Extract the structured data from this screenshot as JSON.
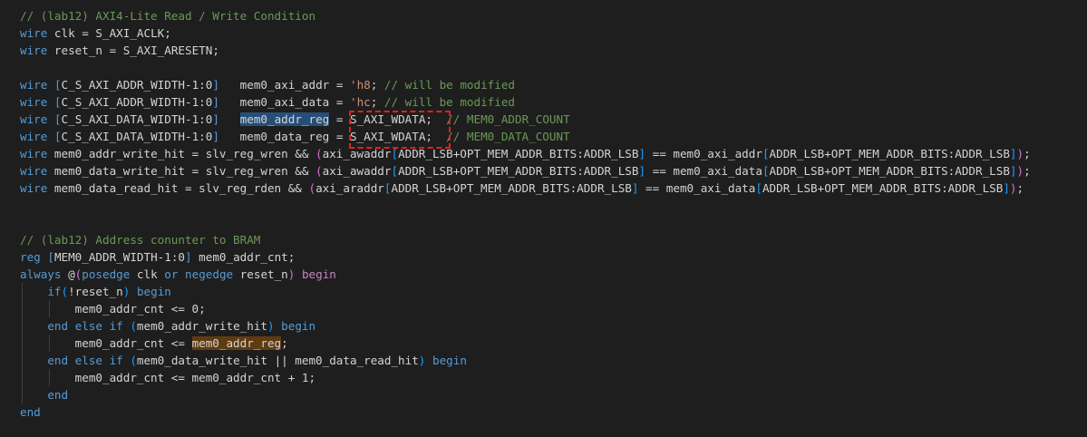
{
  "editor": {
    "lines": [
      [
        {
          "t": "// (lab12) AXI4-Lite Read / Write Condition",
          "c": "comment"
        }
      ],
      [
        {
          "t": "wire",
          "c": "keyword"
        },
        {
          "t": " clk = S_AXI_ACLK;",
          "c": "ident"
        }
      ],
      [
        {
          "t": "wire",
          "c": "keyword"
        },
        {
          "t": " reset_n = S_AXI_ARESETN;",
          "c": "ident"
        }
      ],
      [],
      [
        {
          "t": "wire",
          "c": "keyword"
        },
        {
          "t": " ",
          "c": "ident"
        },
        {
          "t": "[",
          "c": "bracket"
        },
        {
          "t": "C_S_AXI_ADDR_WIDTH-1:0",
          "c": "ident"
        },
        {
          "t": "]",
          "c": "bracket"
        },
        {
          "t": "   mem0_axi_addr = ",
          "c": "ident"
        },
        {
          "t": "'h8",
          "c": "string"
        },
        {
          "t": "; ",
          "c": "ident"
        },
        {
          "t": "// will be modified",
          "c": "comment"
        }
      ],
      [
        {
          "t": "wire",
          "c": "keyword"
        },
        {
          "t": " ",
          "c": "ident"
        },
        {
          "t": "[",
          "c": "bracket"
        },
        {
          "t": "C_S_AXI_ADDR_WIDTH-1:0",
          "c": "ident"
        },
        {
          "t": "]",
          "c": "bracket"
        },
        {
          "t": "   mem0_axi_data = ",
          "c": "ident"
        },
        {
          "t": "'hc",
          "c": "string"
        },
        {
          "t": "; ",
          "c": "ident"
        },
        {
          "t": "// will be modified",
          "c": "comment"
        }
      ],
      [
        {
          "t": "wire",
          "c": "keyword"
        },
        {
          "t": " ",
          "c": "ident"
        },
        {
          "t": "[",
          "c": "bracket"
        },
        {
          "t": "C_S_AXI_DATA_WIDTH-1:0",
          "c": "ident"
        },
        {
          "t": "]",
          "c": "bracket"
        },
        {
          "t": "   ",
          "c": "ident"
        },
        {
          "t": "mem0_addr_reg",
          "c": "sel"
        },
        {
          "t": " = S_AXI_WDATA;  ",
          "c": "ident"
        },
        {
          "t": "// MEM0_ADDR_COUNT",
          "c": "comment"
        }
      ],
      [
        {
          "t": "wire",
          "c": "keyword"
        },
        {
          "t": " ",
          "c": "ident"
        },
        {
          "t": "[",
          "c": "bracket"
        },
        {
          "t": "C_S_AXI_DATA_WIDTH-1:0",
          "c": "ident"
        },
        {
          "t": "]",
          "c": "bracket"
        },
        {
          "t": "   mem0_data_reg = S_AXI_WDATA;  ",
          "c": "ident"
        },
        {
          "t": "// MEM0_DATA_COUNT",
          "c": "comment"
        }
      ],
      [
        {
          "t": "wire",
          "c": "keyword"
        },
        {
          "t": " mem0_addr_write_hit = slv_reg_wren && ",
          "c": "ident"
        },
        {
          "t": "(",
          "c": "bracket2"
        },
        {
          "t": "axi_awaddr",
          "c": "ident"
        },
        {
          "t": "[",
          "c": "bracket3"
        },
        {
          "t": "ADDR_LSB+OPT_MEM_ADDR_BITS:ADDR_LSB",
          "c": "ident"
        },
        {
          "t": "]",
          "c": "bracket3"
        },
        {
          "t": " == mem0_axi_addr",
          "c": "ident"
        },
        {
          "t": "[",
          "c": "bracket3"
        },
        {
          "t": "ADDR_LSB+OPT_MEM_ADDR_BITS:ADDR_LSB",
          "c": "ident"
        },
        {
          "t": "]",
          "c": "bracket3"
        },
        {
          "t": ")",
          "c": "bracket2"
        },
        {
          "t": ";",
          "c": "ident"
        }
      ],
      [
        {
          "t": "wire",
          "c": "keyword"
        },
        {
          "t": " mem0_data_write_hit = slv_reg_wren && ",
          "c": "ident"
        },
        {
          "t": "(",
          "c": "bracket2"
        },
        {
          "t": "axi_awaddr",
          "c": "ident"
        },
        {
          "t": "[",
          "c": "bracket3"
        },
        {
          "t": "ADDR_LSB+OPT_MEM_ADDR_BITS:ADDR_LSB",
          "c": "ident"
        },
        {
          "t": "]",
          "c": "bracket3"
        },
        {
          "t": " == mem0_axi_data",
          "c": "ident"
        },
        {
          "t": "[",
          "c": "bracket3"
        },
        {
          "t": "ADDR_LSB+OPT_MEM_ADDR_BITS:ADDR_LSB",
          "c": "ident"
        },
        {
          "t": "]",
          "c": "bracket3"
        },
        {
          "t": ")",
          "c": "bracket2"
        },
        {
          "t": ";",
          "c": "ident"
        }
      ],
      [
        {
          "t": "wire",
          "c": "keyword"
        },
        {
          "t": " mem0_data_read_hit = slv_reg_rden && ",
          "c": "ident"
        },
        {
          "t": "(",
          "c": "bracket2"
        },
        {
          "t": "axi_araddr",
          "c": "ident"
        },
        {
          "t": "[",
          "c": "bracket3"
        },
        {
          "t": "ADDR_LSB+OPT_MEM_ADDR_BITS:ADDR_LSB",
          "c": "ident"
        },
        {
          "t": "]",
          "c": "bracket3"
        },
        {
          "t": " == mem0_axi_data",
          "c": "ident"
        },
        {
          "t": "[",
          "c": "bracket3"
        },
        {
          "t": "ADDR_LSB+OPT_MEM_ADDR_BITS:ADDR_LSB",
          "c": "ident"
        },
        {
          "t": "]",
          "c": "bracket3"
        },
        {
          "t": ")",
          "c": "bracket2"
        },
        {
          "t": ";",
          "c": "ident"
        }
      ],
      [],
      [],
      [
        {
          "t": "// (lab12) Address conunter to BRAM",
          "c": "comment"
        }
      ],
      [
        {
          "t": "reg",
          "c": "keyword"
        },
        {
          "t": " ",
          "c": "ident"
        },
        {
          "t": "[",
          "c": "bracket"
        },
        {
          "t": "MEM0_ADDR_WIDTH-1:0",
          "c": "ident"
        },
        {
          "t": "]",
          "c": "bracket"
        },
        {
          "t": " mem0_addr_cnt;",
          "c": "ident"
        }
      ],
      [
        {
          "t": "always",
          "c": "keyword"
        },
        {
          "t": " @",
          "c": "ident"
        },
        {
          "t": "(",
          "c": "bracket2"
        },
        {
          "t": "posedge",
          "c": "keyword"
        },
        {
          "t": " clk ",
          "c": "ident"
        },
        {
          "t": "or",
          "c": "keyword"
        },
        {
          "t": " ",
          "c": "ident"
        },
        {
          "t": "negedge",
          "c": "keyword"
        },
        {
          "t": " reset_n",
          "c": "ident"
        },
        {
          "t": ")",
          "c": "bracket2"
        },
        {
          "t": " ",
          "c": "ident"
        },
        {
          "t": "begin",
          "c": "keyword2"
        }
      ],
      [
        {
          "t": "    if",
          "c": "keyword"
        },
        {
          "t": "(",
          "c": "bracket3"
        },
        {
          "t": "!reset_n",
          "c": "ident"
        },
        {
          "t": ")",
          "c": "bracket3"
        },
        {
          "t": " ",
          "c": "ident"
        },
        {
          "t": "begin",
          "c": "keyword"
        }
      ],
      [
        {
          "t": "        mem0_addr_cnt <= 0;",
          "c": "ident"
        }
      ],
      [
        {
          "t": "    end else if",
          "c": "keyword"
        },
        {
          "t": " ",
          "c": "ident"
        },
        {
          "t": "(",
          "c": "bracket3"
        },
        {
          "t": "mem0_addr_write_hit",
          "c": "ident"
        },
        {
          "t": ")",
          "c": "bracket3"
        },
        {
          "t": " ",
          "c": "ident"
        },
        {
          "t": "begin",
          "c": "keyword"
        }
      ],
      [
        {
          "t": "        mem0_addr_cnt <= ",
          "c": "ident"
        },
        {
          "t": "mem0_addr_reg",
          "c": "hl"
        },
        {
          "t": ";",
          "c": "ident"
        }
      ],
      [
        {
          "t": "    end else if",
          "c": "keyword"
        },
        {
          "t": " ",
          "c": "ident"
        },
        {
          "t": "(",
          "c": "bracket3"
        },
        {
          "t": "mem0_data_write_hit || mem0_data_read_hit",
          "c": "ident"
        },
        {
          "t": ")",
          "c": "bracket3"
        },
        {
          "t": " ",
          "c": "ident"
        },
        {
          "t": "begin",
          "c": "keyword"
        }
      ],
      [
        {
          "t": "        mem0_addr_cnt <= mem0_addr_cnt + 1;",
          "c": "ident"
        }
      ],
      [
        {
          "t": "    end",
          "c": "keyword"
        }
      ],
      [
        {
          "t": "end",
          "c": "keyword"
        }
      ]
    ]
  }
}
